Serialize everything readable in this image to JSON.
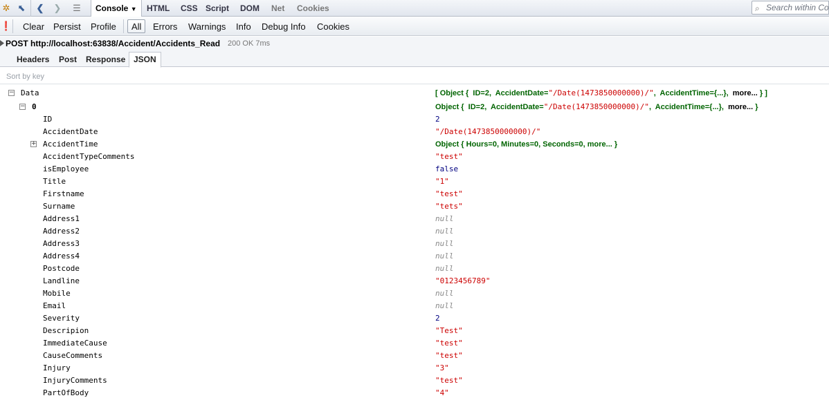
{
  "toolbar": {
    "tabs": [
      "Console",
      "HTML",
      "CSS",
      "Script",
      "DOM",
      "Net",
      "Cookies"
    ],
    "search_placeholder": "Search within Co"
  },
  "console_toolbar": {
    "buttons": [
      "Clear",
      "Persist",
      "Profile"
    ],
    "filters": [
      "All",
      "Errors",
      "Warnings",
      "Info",
      "Debug Info",
      "Cookies"
    ]
  },
  "request": {
    "line": "POST http://localhost:63838/Accident/Accidents_Read",
    "status": "200 OK  7ms"
  },
  "subtabs": [
    "Headers",
    "Post",
    "Response",
    "JSON"
  ],
  "sort_label": "Sort by key",
  "tree": {
    "data_key": "Data",
    "data_summary_open": "[ Object { ",
    "index_key": "0",
    "id_value": "2",
    "accident_date": "\"/Date(1473850000000)/\"",
    "accident_time_summary": "Object { Hours=0,  Minutes=0,  Seconds=0,  more... }",
    "rows": [
      {
        "key": "ID",
        "value": "2",
        "type": "num"
      },
      {
        "key": "AccidentDate",
        "value": "\"/Date(1473850000000)/\"",
        "type": "str"
      },
      {
        "key": "AccidentTime",
        "value": "",
        "type": "obj"
      },
      {
        "key": "AccidentTypeComments",
        "value": "\"test\"",
        "type": "str"
      },
      {
        "key": "isEmployee",
        "value": "false",
        "type": "num"
      },
      {
        "key": "Title",
        "value": "\"1\"",
        "type": "str"
      },
      {
        "key": "Firstname",
        "value": "\"test\"",
        "type": "str"
      },
      {
        "key": "Surname",
        "value": "\"tets\"",
        "type": "str"
      },
      {
        "key": "Address1",
        "value": "null",
        "type": "null"
      },
      {
        "key": "Address2",
        "value": "null",
        "type": "null"
      },
      {
        "key": "Address3",
        "value": "null",
        "type": "null"
      },
      {
        "key": "Address4",
        "value": "null",
        "type": "null"
      },
      {
        "key": "Postcode",
        "value": "null",
        "type": "null"
      },
      {
        "key": "Landline",
        "value": "\"0123456789\"",
        "type": "str"
      },
      {
        "key": "Mobile",
        "value": "null",
        "type": "null"
      },
      {
        "key": "Email",
        "value": "null",
        "type": "null"
      },
      {
        "key": "Severity",
        "value": "2",
        "type": "num"
      },
      {
        "key": "Descripion",
        "value": "\"Test\"",
        "type": "str"
      },
      {
        "key": "ImmediateCause",
        "value": "\"test\"",
        "type": "str"
      },
      {
        "key": "CauseComments",
        "value": "\"test\"",
        "type": "str"
      },
      {
        "key": "Injury",
        "value": "\"3\"",
        "type": "str"
      },
      {
        "key": "InjuryComments",
        "value": "\"test\"",
        "type": "str"
      },
      {
        "key": "PartOfBody",
        "value": "\"4\"",
        "type": "str"
      }
    ]
  }
}
